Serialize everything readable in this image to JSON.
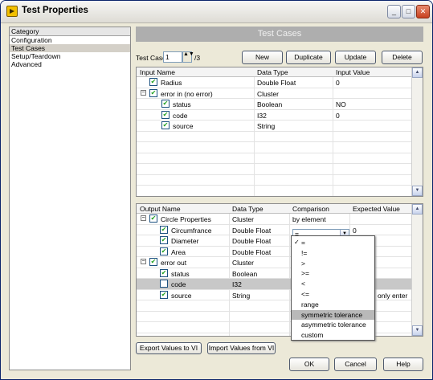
{
  "window": {
    "title": "Test Properties",
    "minimize": "_",
    "maximize": "□",
    "close": "✕"
  },
  "category": {
    "header": "Category",
    "items": [
      "Configuration",
      "Test Cases",
      "Setup/Teardown",
      "Advanced"
    ],
    "selected": "Test Cases"
  },
  "section_title": "Test Cases",
  "test_case": {
    "label": "Test Case",
    "value": "1",
    "of": "/3"
  },
  "buttons": {
    "new": "New",
    "duplicate": "Duplicate",
    "update": "Update",
    "delete": "Delete",
    "export": "Export Values to VI",
    "import": "Import Values from VI",
    "ok": "OK",
    "cancel": "Cancel",
    "help": "Help"
  },
  "input_table": {
    "headers": [
      "Input Name",
      "Data Type",
      "Input Value"
    ],
    "rows": [
      {
        "name": "Radius",
        "type": "Double Float",
        "value": "0",
        "level": 0,
        "expand": ""
      },
      {
        "name": "error in (no error)",
        "type": "Cluster",
        "value": "",
        "level": 0,
        "expand": "-"
      },
      {
        "name": "status",
        "type": "Boolean",
        "value": "NO",
        "level": 1,
        "expand": ""
      },
      {
        "name": "code",
        "type": "I32",
        "value": "0",
        "level": 1,
        "expand": ""
      },
      {
        "name": "source",
        "type": "String",
        "value": "",
        "level": 1,
        "expand": ""
      }
    ]
  },
  "output_table": {
    "headers": [
      "Output Name",
      "Data Type",
      "Comparison",
      "Expected Value"
    ],
    "rows": [
      {
        "name": "Circle Properties",
        "type": "Cluster",
        "comparison": "by element",
        "expected": "",
        "level": 0,
        "expand": "-",
        "checked": true
      },
      {
        "name": "Circumfrance",
        "type": "Double Float",
        "comparison": "=",
        "expected": "0",
        "level": 1,
        "expand": "",
        "checked": true
      },
      {
        "name": "Diameter",
        "type": "Double Float",
        "comparison": "",
        "expected": "",
        "level": 1,
        "expand": "",
        "checked": true
      },
      {
        "name": "Area",
        "type": "Double Float",
        "comparison": "",
        "expected": "",
        "level": 1,
        "expand": "",
        "checked": true
      },
      {
        "name": "error out",
        "type": "Cluster",
        "comparison": "",
        "expected": "",
        "level": 0,
        "expand": "-",
        "checked": true
      },
      {
        "name": "status",
        "type": "Boolean",
        "comparison": "",
        "expected": "",
        "level": 1,
        "expand": "",
        "checked": true
      },
      {
        "name": "code",
        "type": "I32",
        "comparison": "",
        "expected": "",
        "level": 1,
        "expand": "",
        "checked": false
      },
      {
        "name": "source",
        "type": "String",
        "comparison": "",
        "expected": "only enter",
        "level": 1,
        "expand": "",
        "checked": true
      }
    ],
    "highlight_row": "code"
  },
  "comparison_dropdown": {
    "current": "=",
    "options": [
      "=",
      "!=",
      ">",
      ">=",
      "<",
      "<=",
      "range",
      "symmetric tolerance",
      "asymmetric tolerance",
      "custom"
    ],
    "checked": "=",
    "hovered": "symmetric tolerance"
  },
  "icons": {
    "checkbox": "✔",
    "spin": "▲▼",
    "scroll_up": "▲",
    "scroll_down": "▼",
    "dropdown_arrow": "▼",
    "collapse": "−"
  }
}
